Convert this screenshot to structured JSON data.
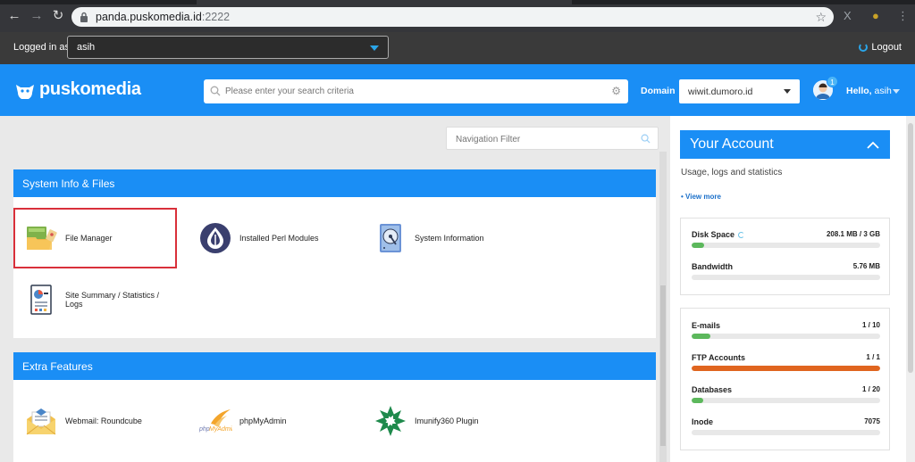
{
  "browser": {
    "url_host": "panda.puskomedia.id",
    "url_port": ":2222"
  },
  "login_bar": {
    "label": "Logged in as",
    "user": "asih",
    "logout": "Logout"
  },
  "header": {
    "brand": "puskomedia",
    "search_placeholder": "Please enter your search criteria",
    "domain_label": "Domain",
    "domain_value": "wiwit.dumoro.id",
    "notification_count": "1",
    "greeting": "Hello,",
    "user": "asih"
  },
  "main": {
    "nav_filter_placeholder": "Navigation Filter",
    "panels": [
      {
        "title": "System Info & Files",
        "items": [
          {
            "label": "File Manager",
            "icon": "file-manager-icon"
          },
          {
            "label": "Installed Perl Modules",
            "icon": "onion-icon"
          },
          {
            "label": "System Information",
            "icon": "hard-drive-icon"
          },
          {
            "label": "Site Summary / Statistics / Logs",
            "icon": "report-icon"
          }
        ]
      },
      {
        "title": "Extra Features",
        "items": [
          {
            "label": "Webmail: Roundcube",
            "icon": "webmail-icon"
          },
          {
            "label": "phpMyAdmin",
            "icon": "phpmyadmin-icon"
          },
          {
            "label": "Imunify360 Plugin",
            "icon": "imunify-icon"
          }
        ]
      }
    ]
  },
  "account": {
    "title": "Your Account",
    "subtitle": "Usage, logs and statistics",
    "view_more": "• View more",
    "usage": [
      {
        "name": "Disk Space",
        "value": "208.1 MB / 3 GB",
        "fraction": 0.068,
        "color": "#5cb85c"
      },
      {
        "name": "Bandwidth",
        "value": "5.76 MB",
        "fraction": 0.0,
        "color": "#5cb85c"
      }
    ],
    "limits": [
      {
        "name": "E-mails",
        "value": "1 / 10",
        "fraction": 0.1,
        "color": "#5cb85c"
      },
      {
        "name": "FTP Accounts",
        "value": "1 / 1",
        "fraction": 1.0,
        "color": "#e0651f"
      },
      {
        "name": "Databases",
        "value": "1 / 20",
        "fraction": 0.05,
        "color": "#5cb85c"
      },
      {
        "name": "Inode",
        "value": "7075",
        "fraction": 0.0,
        "color": "#5cb85c"
      }
    ]
  }
}
